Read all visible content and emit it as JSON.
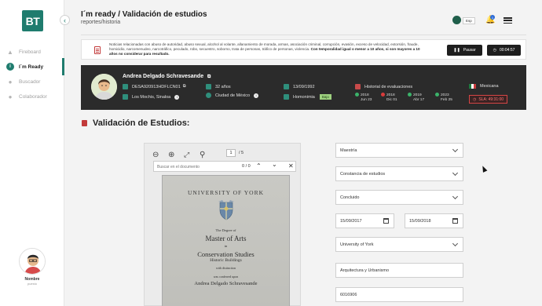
{
  "app": {
    "logo": "BT",
    "lang": "Esp",
    "notifications": "1"
  },
  "sidebar": {
    "items": [
      {
        "label": "Fireboard",
        "icon": "flame-icon",
        "active": false
      },
      {
        "label": "I´m Ready",
        "icon": "check-circle-icon",
        "active": true
      },
      {
        "label": "Buscador",
        "icon": "users-icon",
        "active": false
      },
      {
        "label": "Colaborador",
        "icon": "group-icon",
        "active": false
      }
    ],
    "profile": {
      "name": "Nombre",
      "role": "puesto"
    }
  },
  "header": {
    "title": "I´m ready / Validación de estudios",
    "breadcrumb": "reportes/historia"
  },
  "notice": {
    "text": "Noticias relacionadas con abuso de autoridad, abuso sexual, alcohol al volante, allanamiento de morada, armas, asociación criminal, corrupción, evasión, exceso de velocidad, extorsión, fraude, homicidio, narcomenudeo, narcotráfico, peculado, robo, secuestro, soborno, trata de personas, tráfico de personas, violencia.",
    "bold_text": "Con temporalidad igual o menor a 10 años, si son mayores a 10 años no considerar para resultado.",
    "pause_label": "Pausar",
    "timer": "00:04:57"
  },
  "person": {
    "name": "Andrea Delgado Schravesande",
    "curp": "DESA920913HDFLCN01",
    "location": "Los Mochis, Sinaloa",
    "age": "32 años",
    "birthplace": "Ciudad de México",
    "birthdate": "13/09/1992",
    "homonimia_label": "Homonimia",
    "homonimia_level": "Bajo",
    "history_label": "Historial de evaluaciones",
    "nationality": "Mexicana",
    "sla": "SLA: 49:31:00",
    "evaluations": [
      {
        "year": "2018",
        "date": "Jun 23",
        "status": "ok"
      },
      {
        "year": "2018",
        "date": "Dic 01",
        "status": "fail"
      },
      {
        "year": "2019",
        "date": "Abr 17",
        "status": "ok"
      },
      {
        "year": "2023",
        "date": "Feb 25",
        "status": "ok"
      }
    ]
  },
  "section": {
    "title": "Validación de Estudios:"
  },
  "viewer": {
    "page": "1",
    "page_total": "/ 5",
    "search_placeholder": "Buscar en el documento",
    "match_count": "0 / 0",
    "document": {
      "university": "UNIVERSITY OF YORK",
      "line1": "The Degree of",
      "degree": "Master of Arts",
      "in": "in",
      "field": "Conservation Studies",
      "field_sub": "Historic Buildings",
      "honors": "with distinction",
      "conferred": "was conferred upon",
      "holder": "Andrea Delgado Schravesande"
    }
  },
  "form": {
    "degree_level": "Maestría",
    "document_type": "Constancia de estudios",
    "status": "Concluido",
    "start_date": "15/09/2017",
    "end_date": "15/09/2018",
    "institution": "University of York",
    "field": "Arquitectura y Urbanismo",
    "license": "6016906"
  }
}
